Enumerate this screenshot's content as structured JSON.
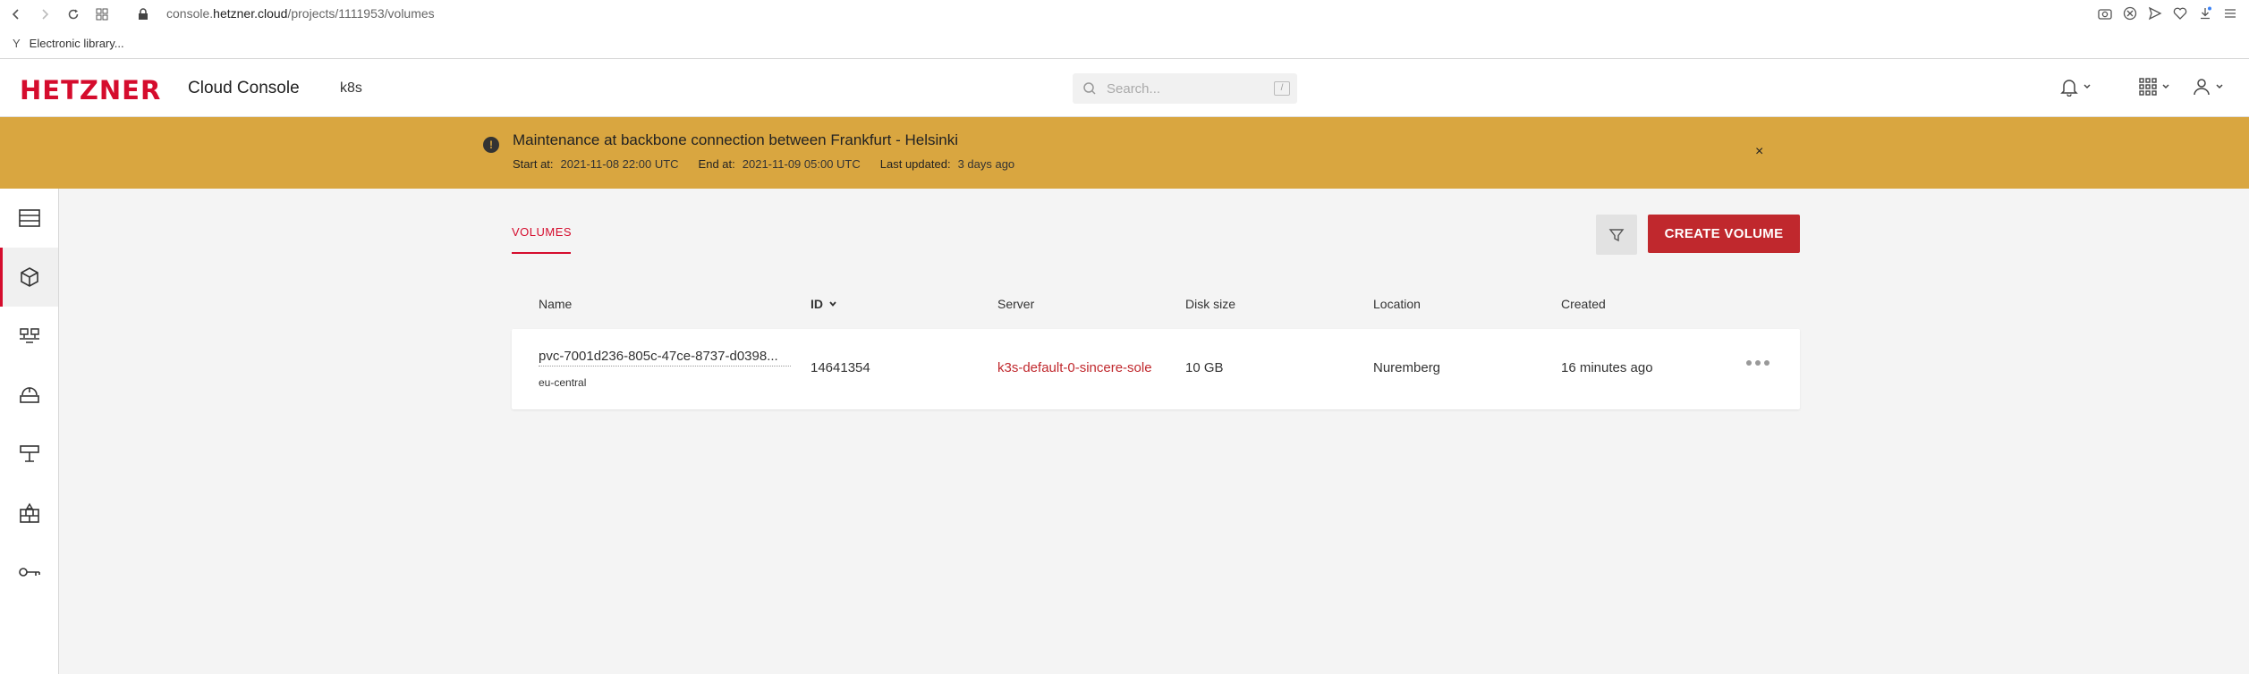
{
  "browser": {
    "url_prefix": "console.",
    "url_host": "hetzner.cloud",
    "url_path": "/projects/1111953/volumes",
    "bookmark_label": "Electronic library..."
  },
  "header": {
    "logo": "HETZNER",
    "app_title": "Cloud Console",
    "project": "k8s",
    "search_placeholder": "Search...",
    "search_shortcut": "/"
  },
  "banner": {
    "title": "Maintenance at backbone connection between Frankfurt - Helsinki",
    "start_label": "Start at:",
    "start_value": "2021-11-08 22:00 UTC",
    "end_label": "End at:",
    "end_value": "2021-11-09 05:00 UTC",
    "updated_label": "Last updated:",
    "updated_value": "3 days ago",
    "close": "×"
  },
  "main": {
    "tab_label": "VOLUMES",
    "create_label": "CREATE VOLUME",
    "columns": {
      "name": "Name",
      "id": "ID",
      "server": "Server",
      "disk_size": "Disk size",
      "location": "Location",
      "created": "Created"
    },
    "rows": [
      {
        "name": "pvc-7001d236-805c-47ce-8737-d0398...",
        "region": "eu-central",
        "id": "14641354",
        "server": "k3s-default-0-sincere-sole",
        "disk_size": "10 GB",
        "location": "Nuremberg",
        "created": "16 minutes ago"
      }
    ]
  },
  "colors": {
    "brand": "#d50c2d",
    "banner": "#d9a640",
    "create_button": "#c0282d"
  }
}
